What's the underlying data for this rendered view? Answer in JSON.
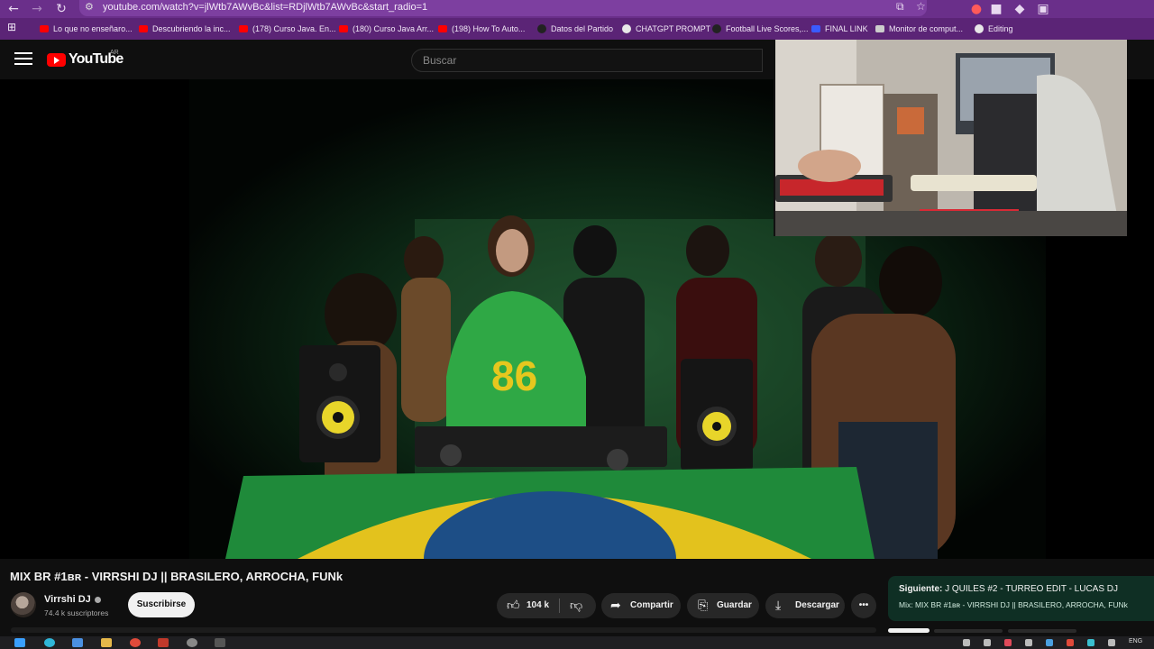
{
  "browser": {
    "url": "youtube.com/watch?v=jlWtb7AWvBc&list=RDjlWtb7AWvBc&start_radio=1",
    "bookmarks": [
      {
        "label": "Lo que no enseñaro...",
        "icon": "youtube-icon"
      },
      {
        "label": "Descubriendo la inc...",
        "icon": "youtube-icon"
      },
      {
        "label": "(178) Curso Java. En...",
        "icon": "youtube-icon"
      },
      {
        "label": "(180) Curso Java Arr...",
        "icon": "youtube-icon"
      },
      {
        "label": "(198) How To Auto...",
        "icon": "youtube-icon"
      },
      {
        "label": "Datos del Partido",
        "icon": "ball-icon"
      },
      {
        "label": "CHATGPT PROMPT",
        "icon": "openai-icon"
      },
      {
        "label": "Football Live Scores,...",
        "icon": "scores-icon"
      },
      {
        "label": "FINAL LINK",
        "icon": "dollar-icon"
      },
      {
        "label": "Monitor de comput...",
        "icon": "globe-icon"
      },
      {
        "label": "Editing",
        "icon": "glasses-icon"
      }
    ]
  },
  "youtube": {
    "logo_text": "YouTube",
    "country_code": "AR",
    "search_placeholder": "Buscar"
  },
  "video": {
    "title": "MIX BR #1ʙʀ - VIRRSHI DJ || BRASILERO, ARROCHA, FUNk",
    "channel": "Virrshi DJ",
    "subscribers": "74.4 k suscriptores",
    "subscribe_label": "Suscribirse",
    "likes": "104 k",
    "share_label": "Compartir",
    "save_label": "Guardar",
    "download_label": "Descargar",
    "more_label": "•••"
  },
  "next": {
    "prefix": "Siguiente:",
    "title": "J QUILES #2 - TURREO EDIT - LUCAS DJ",
    "subtitle": "Mix: MIX BR #1ʙʀ - VIRRSHI DJ || BRASILERO, ARROCHA, FUNk"
  },
  "taskbar": {
    "language": "ENG"
  },
  "colors": {
    "browser_frame": "#6a2f8a",
    "bookmarks_bar": "#5b2476",
    "youtube_red": "#ff0000",
    "page_bg": "#0f0f0f",
    "next_card_bg": "#0f2f24"
  }
}
